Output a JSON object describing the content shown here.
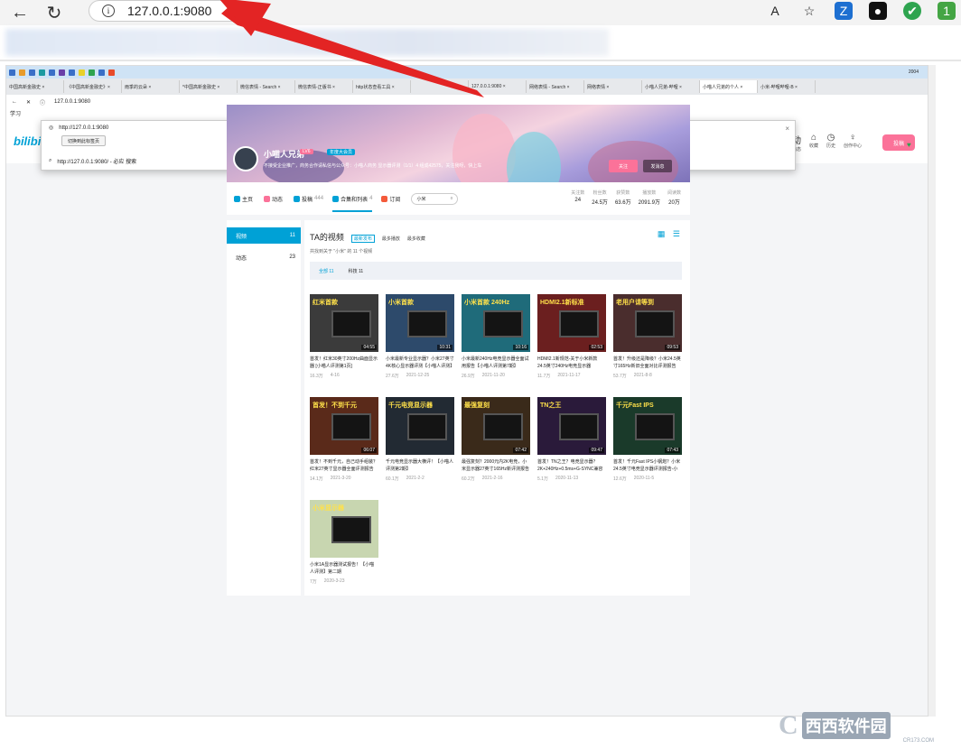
{
  "outer_browser": {
    "url": "127.0.0.1:9080",
    "back_icon": "←",
    "reload_icon": "↻",
    "read_aloud_icon": "A",
    "favorite_icon": "☆",
    "ext1": "Z",
    "ext2": "●",
    "ext3": "✔",
    "ext4": "1"
  },
  "inner_browser": {
    "tabs": [
      "中国高新金融史 ×",
      "《中国高新金融史》×",
      "雨季的云朵 ×",
      "*中国高新金融史 ×",
      "微信表情 - Search ×",
      "微信表情-正版书 ×",
      "http状态查看工具 ×",
      "",
      "127.0.0.1:9080 ×",
      "网络表情 - Search ×",
      "网络表情 ×",
      "小喵人兄弟-哔哩 ×",
      "小喵人兄弟的个人 ×",
      "小米-哔哩哔哩-B ×"
    ],
    "active_tab": 12,
    "address": "127.0.0.1:9080",
    "bookmark_label": "学习",
    "taskbar_time": "2004"
  },
  "dropdown": {
    "url_suggestion": "http://127.0.0.1:9080",
    "action_button": "切换到此标签页",
    "search_suggestion": "http://127.0.0.1:9080/ - 必应 搜索"
  },
  "bili_header": {
    "logo": "bilibili",
    "icons": [
      {
        "icon": "动",
        "label": "动态"
      },
      {
        "icon": "⌂",
        "label": "收藏"
      },
      {
        "icon": "◷",
        "label": "历史"
      },
      {
        "icon": "♀",
        "label": "创作中心"
      }
    ],
    "upload": "投稿"
  },
  "profile": {
    "name": "小喵人兄弟",
    "level": "LV6",
    "vip": "年度大会员",
    "sign": "不接受企业推广，商务合作请私信与公众号：小喵人商务 显示器评测（1/1）4 组成42575，关注我呀，快上车",
    "follow": "关注",
    "message": "发消息"
  },
  "nav": {
    "items": [
      {
        "label": "主页",
        "count": "",
        "color": "#00a1d6"
      },
      {
        "label": "动态",
        "count": "",
        "color": "#fb7299"
      },
      {
        "label": "投稿",
        "count": "444",
        "color": "#00a1d6"
      },
      {
        "label": "合集和列表",
        "count": "4",
        "color": "#00a1d6"
      },
      {
        "label": "订阅",
        "count": "",
        "color": "#f45a3a"
      }
    ],
    "active": 3,
    "search_value": "小米",
    "search_icon": "○"
  },
  "stats": [
    {
      "label": "关注数",
      "value": "24"
    },
    {
      "label": "粉丝数",
      "value": "24.5万"
    },
    {
      "label": "获赞数",
      "value": "63.6万"
    },
    {
      "label": "播放数",
      "value": "2091.9万"
    },
    {
      "label": "阅读数",
      "value": "20万"
    }
  ],
  "sidebar": [
    {
      "label": "视频",
      "count": "11"
    },
    {
      "label": "动态",
      "count": "23"
    }
  ],
  "main": {
    "title": "TA的视频",
    "sorts": [
      "最新发布",
      "最多播放",
      "最多收藏"
    ],
    "total": "共找到关于 \"小米\" 的 11 个视频",
    "categories": [
      "全部 11",
      "科技 11"
    ],
    "view_icons": "▦ ☰"
  },
  "videos": [
    {
      "thumb": "红米首款",
      "duration": "04:55",
      "title": "首发！红米30英寸200Hz曲面显示器 [小喵人评测第1页]",
      "plays": "16.3万",
      "date": "4-16",
      "bg": "#3b3b3b"
    },
    {
      "thumb": "小米首款",
      "duration": "10:31",
      "title": "小米最新专业显示器？小米27英寸4K核心显示器评测【小喵人评测】",
      "plays": "27.6万",
      "date": "2021-12-25",
      "bg": "#2d4a6b"
    },
    {
      "thumb": "小米首款 240Hz",
      "duration": "10:16",
      "title": "小米最新240Hz电竞显示器全面试用报告【小喵人评测第7期】",
      "plays": "26.9万",
      "date": "2021-11-20",
      "bg": "#1f6b7a"
    },
    {
      "thumb": "HDMI2.1新标准",
      "duration": "02:53",
      "title": "HDMI2.1新规范-关于小米新款24.5英寸240Hz电竞显示器HDMI2.1接",
      "plays": "11.7万",
      "date": "2021-11-17",
      "bg": "#6b1f1f"
    },
    {
      "thumb": "老用户请等到",
      "duration": "09:53",
      "title": "首发！升级还是降级？小米24.5英寸165Hz新旧全面对比评测报告",
      "plays": "53.7万",
      "date": "2021-8-8",
      "bg": "#4a2d2d"
    },
    {
      "thumb": "首发！不到千元",
      "duration": "06:07",
      "title": "首发！不到千元，自己动手组装？红米27英寸显示器全面评测报告",
      "plays": "14.1万",
      "date": "2021-3-20",
      "bg": "#5a2a1a"
    },
    {
      "thumb": "千元电竞显示器",
      "duration": "",
      "title": "千元电竞显示器大横评！【小喵人评测第2期】",
      "plays": "60.1万",
      "date": "2021-2-2",
      "bg": "#222a33"
    },
    {
      "thumb": "最强复刻",
      "duration": "07:42",
      "title": "最强复刻？2000元内2K电竞，小米显示器27英寸165Hz新评测报告",
      "plays": "60.2万",
      "date": "2021-2-16",
      "bg": "#3a2a1a"
    },
    {
      "thumb": "TN之王",
      "duration": "09:47",
      "title": "首发！TN之王？电竞显示器？2K+240Hz+0.5ms+G-SYNC兼容",
      "plays": "5.1万",
      "date": "2020-11-13",
      "bg": "#2a1a3a"
    },
    {
      "thumb": "千元Fast IPS",
      "duration": "07:43",
      "title": "首发！千元Fast IPS小钢炮？小米24.5英寸电竞显示器评测报告-小喵",
      "plays": "12.6万",
      "date": "2020-11-5",
      "bg": "#1a3a2a"
    },
    {
      "thumb": "小米显示器",
      "duration": "",
      "title": "小米1A显示器测试报告！【小喵人评测】第二期",
      "plays": "7万",
      "date": "2020-3-23",
      "bg": "#c8d6b0"
    }
  ],
  "watermark": {
    "logo": "C",
    "brand": "西西软件园",
    "domain": "CR173.COM"
  }
}
